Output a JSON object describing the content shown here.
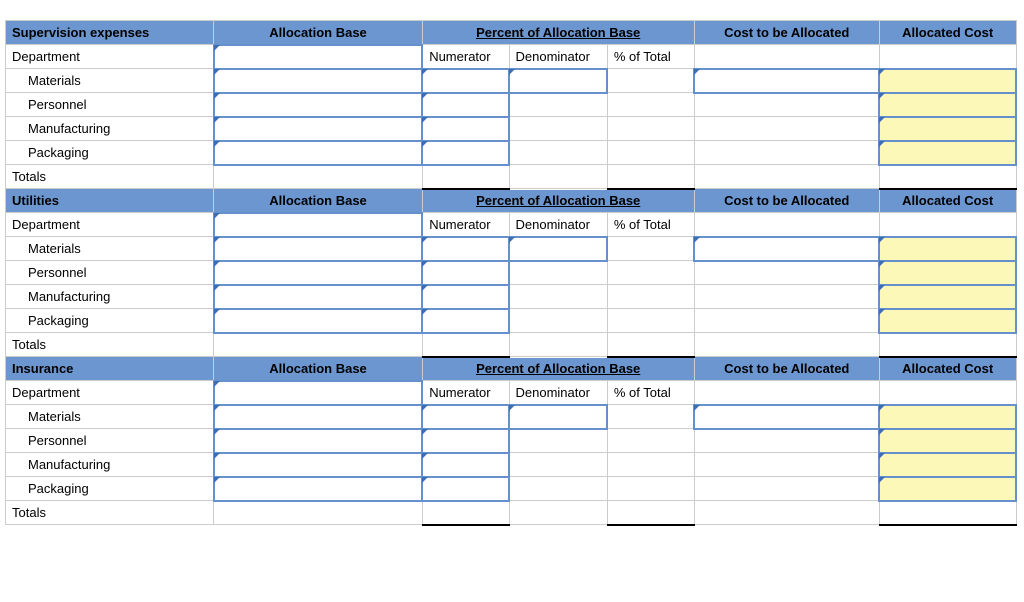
{
  "columns": {
    "allocation_base": "Allocation Base",
    "percent_base": "Percent of Allocation Base",
    "cost_allocated": "Cost to be Allocated",
    "allocated_cost": "Allocated Cost",
    "numerator": "Numerator",
    "denominator": "Denominator",
    "pct_total": "% of Total"
  },
  "labels": {
    "department": "Department",
    "materials": "Materials",
    "personnel": "Personnel",
    "manufacturing": "Manufacturing",
    "packaging": "Packaging",
    "totals": "Totals"
  },
  "sections": [
    {
      "title": "Supervision expenses"
    },
    {
      "title": "Utilities"
    },
    {
      "title": "Insurance"
    }
  ]
}
